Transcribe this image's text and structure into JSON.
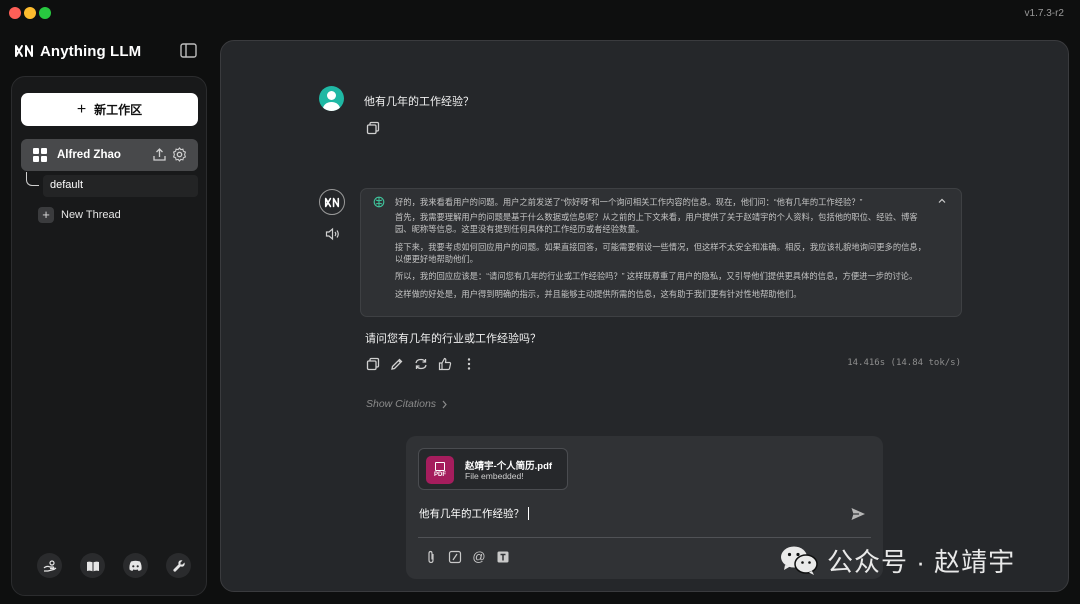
{
  "window": {
    "version": "v1.7.3-r2"
  },
  "brand": {
    "name": "Anything LLM"
  },
  "sidebar": {
    "new_workspace_label": "新工作区",
    "workspace": {
      "name": "Alfred Zhao"
    },
    "threads": [
      {
        "label": "default"
      }
    ],
    "new_thread_label": "New Thread",
    "footer_icons": [
      "community-hub-icon",
      "docs-book-icon",
      "discord-icon",
      "settings-wrench-icon"
    ]
  },
  "chat": {
    "user_message": "他有几年的工作经验？",
    "thinking": [
      "好的，我来看看用户的问题。用户之前发送了“你好呀”和一个询问相关工作内容的信息。现在，他们问：“他有几年的工作经验？”",
      "首先，我需要理解用户的问题是基于什么数据或信息呢？从之前的上下文来看，用户提供了关于赵靖宇的个人资料，包括他的职位、经验、博客园、昵称等信息。这里没有提到任何具体的工作经历或者经验数量。",
      "接下来，我要考虑如何回应用户的问题。如果直接回答，可能需要假设一些情况，但这样不太安全和准确。相反，我应该礼貌地询问更多的信息，以便更好地帮助他们。",
      "所以，我的回应应该是：“请问您有几年的行业或工作经验吗？” 这样既尊重了用户的隐私，又引导他们提供更具体的信息，方便进一步的讨论。",
      "这样做的好处是，用户得到明确的指示，并且能够主动提供所需的信息，这有助于我们更有针对性地帮助他们。"
    ],
    "assistant_answer": "请问您有几年的行业或工作经验吗？",
    "speed": "14.416s (14.84 tok/s)",
    "show_citations_label": "Show Citations"
  },
  "composer": {
    "attachment": {
      "name": "赵靖宇-个人简历.pdf",
      "status": "File embedded!",
      "type_label": "PDF"
    },
    "input_value": "他有几年的工作经验？",
    "at_symbol": "@"
  },
  "watermark": {
    "text": "公众号 · 赵靖宇"
  },
  "colors": {
    "accent_avatar": "#1fb8a4",
    "pdf_badge": "#a51d5d",
    "background": "#0e0f0f",
    "panel": "#25272a"
  }
}
